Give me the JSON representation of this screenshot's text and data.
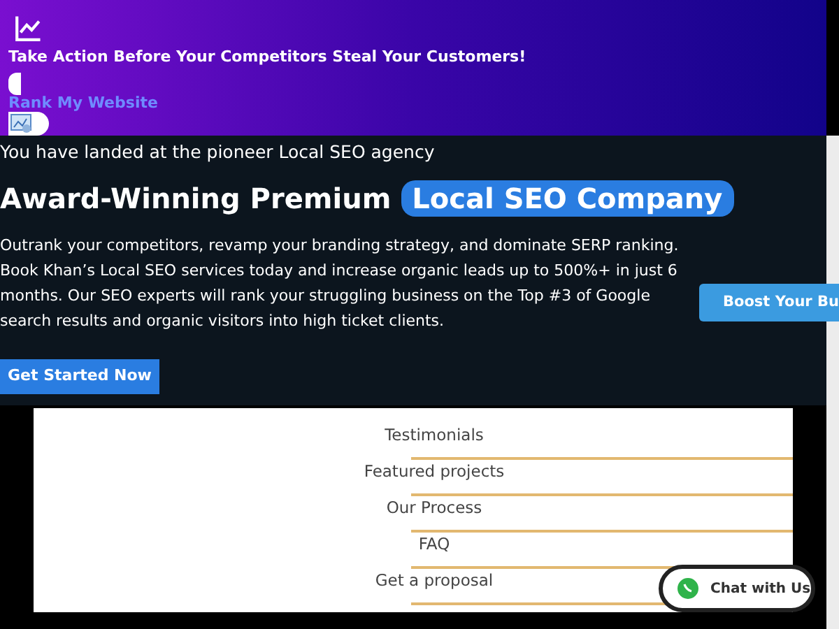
{
  "banner": {
    "headline": "Take Action Before Your Competitors Steal Your Customers!",
    "link": "Rank My Website"
  },
  "hero": {
    "eyebrow": "You have landed at the pioneer Local SEO agency",
    "title": "Award-Winning Premium",
    "title_highlight": "Local SEO Company",
    "paragraph": "Outrank your competitors, revamp your branding strategy, and dominate SERP ranking. Book Khan’s Local SEO services today and increase organic leads up to  500%+ in just 6 months. Our SEO experts will rank your struggling business on the Top #3 of Google search results and organic visitors into high ticket clients.",
    "cta": "Get Started Now",
    "side_button": "Boost Your Bu"
  },
  "menu": {
    "items": [
      {
        "label": "Testimonials"
      },
      {
        "label": "Featured projects"
      },
      {
        "label": "Our Process"
      },
      {
        "label": "FAQ"
      },
      {
        "label": "Get a proposal"
      }
    ]
  },
  "chat": {
    "label": "Chat with Us"
  }
}
